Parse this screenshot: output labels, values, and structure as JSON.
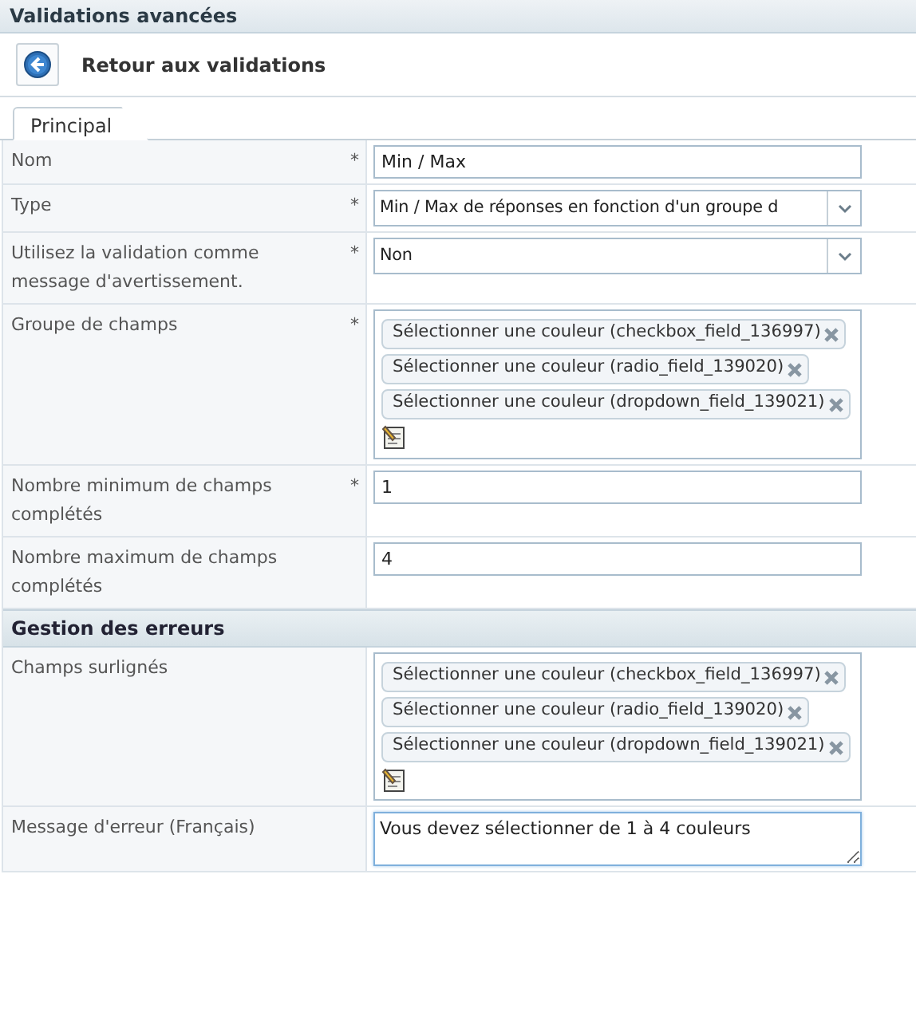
{
  "header": {
    "title": "Validations avancées"
  },
  "toolbar": {
    "back_button": "Retour aux validations"
  },
  "tabs": [
    {
      "label": "Principal",
      "selected": true
    }
  ],
  "sections": [
    {
      "rows": [
        {
          "kind": "text",
          "label": "Nom",
          "required": "*",
          "value": "Min / Max"
        },
        {
          "kind": "select",
          "label": "Type",
          "required": "*",
          "value": "Min / Max de réponses en fonction d'un groupe d"
        },
        {
          "kind": "select",
          "label": "Utilisez la validation comme message d'avertissement.",
          "required": "*",
          "value": "Non"
        },
        {
          "kind": "tags",
          "label": "Groupe de champs",
          "required": "*",
          "tags": [
            "Sélectionner une couleur (checkbox_field_136997)",
            "Sélectionner une couleur (radio_field_139020)",
            "Sélectionner une couleur (dropdown_field_139021)"
          ]
        },
        {
          "kind": "text",
          "label": "Nombre minimum de champs complétés",
          "required": "*",
          "value": "1"
        },
        {
          "kind": "text",
          "label": "Nombre maximum de champs complétés",
          "value": "4"
        }
      ]
    },
    {
      "title": "Gestion des erreurs",
      "rows": [
        {
          "kind": "tags",
          "label": "Champs surlignés",
          "tags": [
            "Sélectionner une couleur (checkbox_field_136997)",
            "Sélectionner une couleur (radio_field_139020)",
            "Sélectionner une couleur (dropdown_field_139021)"
          ]
        },
        {
          "kind": "textarea",
          "label": "Message d'erreur (Français)",
          "focused": true,
          "value": "Vous devez sélectionner de 1 à 4 couleurs"
        }
      ]
    }
  ]
}
